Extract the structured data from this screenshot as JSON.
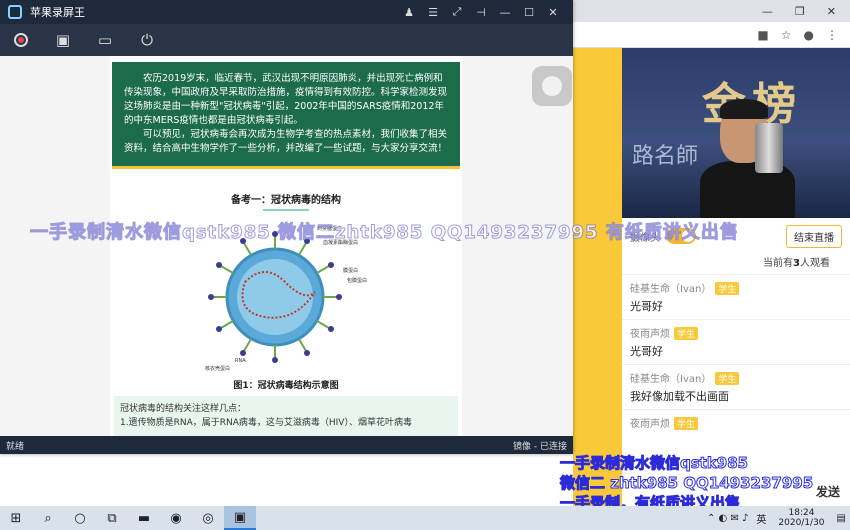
{
  "recorder": {
    "title": "苹果录屏王",
    "window_buttons": [
      "ᴿ",
      "≡",
      "⤢",
      "⊣",
      "—",
      "☐",
      "✕"
    ],
    "status_left": "就绪",
    "status_right": "镜像 - 已连接"
  },
  "doc": {
    "intro_p1": "农历2019岁末，临近春节，武汉出现不明原因肺炎，并出现死亡病例和传染现象，中国政府及早采取防治措施，疫情得到有效防控。科学家检测发现这场肺炎是由一种新型\"冠状病毒\"引起，2002年中国的SARS疫情和2012年的中东MERS疫情也都是由冠状病毒引起。",
    "intro_p2": "可以预见，冠状病毒会再次成为生物学考查的热点素材，我们收集了相关资料，结合高中生物学作了一些分析，并改编了一些试题，与大家分享交流！",
    "section_title": "备考一：冠状病毒的结构",
    "fig_labels": {
      "membrane": "刺突糖蛋白",
      "hemagglutinin": "血凝素酯酶蛋白",
      "envelope": "膜蛋白",
      "spike": "包膜蛋白",
      "nucleocapsid": "核衣壳蛋白",
      "rna": "RNA"
    },
    "fig_caption": "图1：冠状病毒结构示意图",
    "focus_title": "冠状病毒的结构关注这样几点：",
    "focus_item1": "1.遗传物质是RNA，属于RNA病毒，这与艾滋病毒（HIV）、烟草花叶病毒"
  },
  "watermarks": {
    "line_main": "一手录制清水微信qstk985   微信二zhtk985   QQ1493237995   有纸质讲义出售",
    "line_a": "一手录制清水微信qstk985",
    "line_b": "微信二 zhtk985  QQ1493237995",
    "line_c": "一手录制，有纸质讲义出售"
  },
  "live": {
    "camera_label": "摄像头",
    "end_button": "结束直播",
    "viewers_prefix": "当前有",
    "viewers_count": "3",
    "viewers_suffix": "人观看",
    "send_button": "发送",
    "chats": [
      {
        "name": "硅基生命（Ivan）",
        "badge": "学生",
        "msg": "光哥好"
      },
      {
        "name": "夜雨声烦",
        "badge": "学生",
        "msg": "光哥好"
      },
      {
        "name": "硅基生命（Ivan）",
        "badge": "学生",
        "msg": "我好像加载不出画面"
      },
      {
        "name": "夜雨声烦",
        "badge": "学生",
        "msg": ""
      }
    ]
  },
  "taskbar": {
    "lang": "英",
    "time": "18:24",
    "date": "2020/1/30"
  },
  "colors": {
    "doc_green": "#1c6b4a",
    "accent_yellow": "#f9c93a",
    "recorder_dark": "#1e2a3c"
  }
}
